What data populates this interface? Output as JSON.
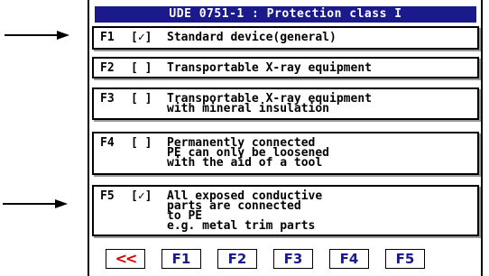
{
  "title": "UDE 0751-1 : Protection class I",
  "items": [
    {
      "code": "F1",
      "check": "[✓]",
      "text": "Standard device(general)"
    },
    {
      "code": "F2",
      "check": "[ ]",
      "text": "Transportable X-ray equipment"
    },
    {
      "code": "F3",
      "check": "[ ]",
      "text": "Transportable X-ray equipment\nwith mineral insulation"
    },
    {
      "code": "F4",
      "check": "[ ]",
      "text": "Permanently connected\nPE can only be loosened\nwith the aid of a tool"
    },
    {
      "code": "F5",
      "check": "[✓]",
      "text": "All exposed conductive\nparts are connected\nto PE\ne.g. metal trim parts"
    }
  ],
  "buttons": {
    "back": "<<",
    "f1": "F1",
    "f2": "F2",
    "f3": "F3",
    "f4": "F4",
    "f5": "F5"
  },
  "colors": {
    "title_bar": "#1a1a8c",
    "button_text": "#1a1a8c",
    "back_button_text": "#d00000"
  }
}
